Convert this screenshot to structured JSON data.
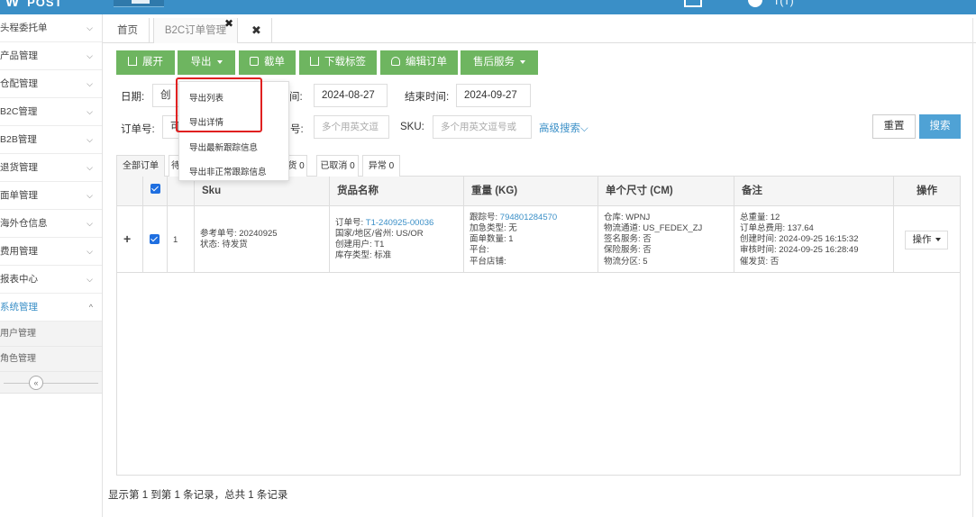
{
  "topbar": {
    "logo": "POST",
    "user": "T(T)"
  },
  "sidebar": {
    "items": [
      {
        "label": "头程委托单",
        "chevron": "down"
      },
      {
        "label": "产品管理",
        "chevron": "down"
      },
      {
        "label": "仓配管理",
        "chevron": "down"
      },
      {
        "label": "B2C管理",
        "chevron": "down"
      },
      {
        "label": "B2B管理",
        "chevron": "down"
      },
      {
        "label": "退货管理",
        "chevron": "down"
      },
      {
        "label": "面单管理",
        "chevron": "down"
      },
      {
        "label": "海外仓信息",
        "chevron": "down"
      },
      {
        "label": "费用管理",
        "chevron": "down"
      },
      {
        "label": "报表中心",
        "chevron": "down"
      },
      {
        "label": "系统管理",
        "chevron": "up"
      }
    ],
    "sub_items": [
      "用户管理",
      "角色管理"
    ],
    "collapse_glyph": "«",
    "chevron_down": "⌵",
    "chevron_up": "^"
  },
  "tabs": {
    "home": "首页",
    "b2c": "B2C订单管理",
    "tab_x": "✖",
    "close_all": "✖"
  },
  "toolbar": {
    "expand": "展开",
    "export": "导出",
    "intercept": "截单",
    "download_label": "下载标签",
    "edit_order": "编辑订单",
    "after_sales": "售后服务"
  },
  "filters": {
    "date_label": "日期:",
    "date_select": "创",
    "start_label_tail": "间:",
    "start_value": "2024-08-27",
    "end_label": "结束时间:",
    "end_value": "2024-09-27",
    "order_label": "订单号:",
    "order_value_partial": "可",
    "tracking_label_tail": "号:",
    "tracking_placeholder": "多个用英文逗",
    "sku_label": "SKU:",
    "sku_placeholder": "多个用英文逗号或",
    "advanced": "高级搜索"
  },
  "buttons": {
    "reset": "重置",
    "search": "搜索"
  },
  "status_tabs": [
    "全部订单",
    "待",
    "货 0",
    "已取消 0",
    "异常 0"
  ],
  "table": {
    "headers": [
      "Sku",
      "货品名称",
      "重量 (KG)",
      "单个尺寸 (CM)",
      "备注",
      "操作"
    ],
    "row": {
      "expand_glyph": "+",
      "index": "1",
      "sku_lines": [
        "参考单号: 20240925",
        "状态: 待发货"
      ],
      "goods": {
        "order_label": "订单号: ",
        "order_no": "T1-240925-00036",
        "lines": [
          "国家/地区/省州: US/OR",
          "创建用户: T1",
          "库存类型: 标准"
        ]
      },
      "weight": {
        "tracking_label": "跟踪号: ",
        "tracking_no": "794801284570",
        "lines": [
          "加急类型: 无",
          "面单数量: 1",
          "平台:",
          "平台店铺:"
        ]
      },
      "size_lines": [
        "仓库: WPNJ",
        "物流通道: US_FEDEX_ZJ",
        "签名服务: 否",
        "保险服务: 否",
        "物流分区: 5"
      ],
      "remark_lines": [
        "总重量: 12",
        "订单总费用: 137.64",
        "创建时间: 2024-09-25 16:15:32",
        "审核时间: 2024-09-25 16:28:49",
        "催发货: 否"
      ],
      "action": "操作"
    }
  },
  "export_menu": [
    "导出列表",
    "导出详情",
    "导出最新跟踪信息",
    "导出非正常跟踪信息"
  ],
  "footer": "显示第 1 到第 1 条记录，总共 1 条记录",
  "colors": {
    "brand": "#3a8fc7",
    "green": "#6eb560",
    "search": "#4fa2d5",
    "highlight": "#e02020",
    "checkbox": "#1f6fe0"
  }
}
